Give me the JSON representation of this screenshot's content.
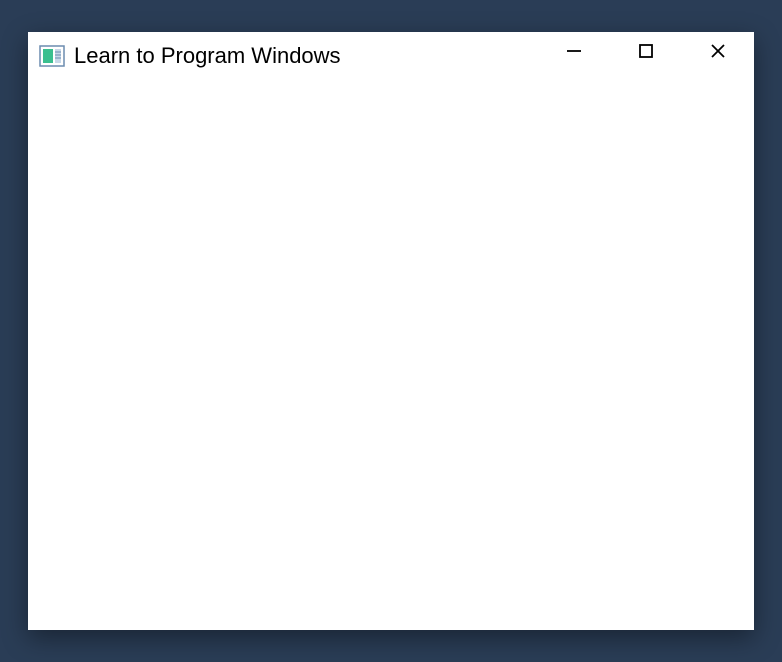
{
  "window": {
    "title": "Learn to Program Windows"
  }
}
